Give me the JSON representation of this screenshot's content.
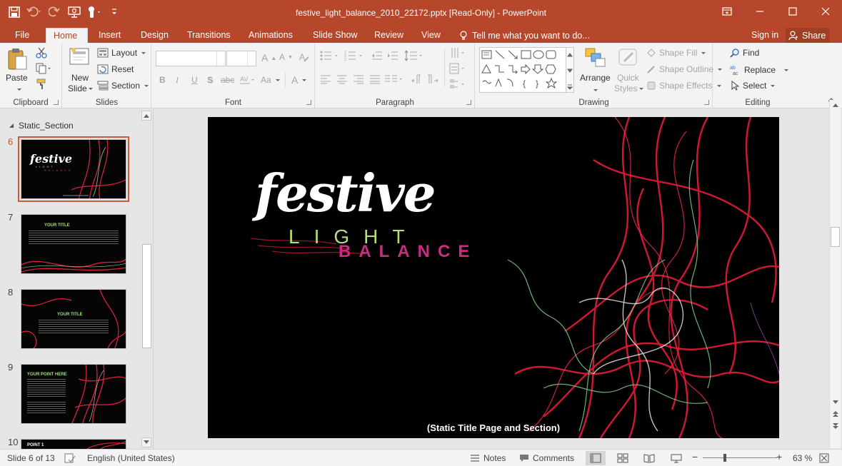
{
  "window": {
    "title": "festive_light_balance_2010_22172.pptx [Read-Only] - PowerPoint"
  },
  "quick_access": [
    "save-icon",
    "undo-icon",
    "redo-icon",
    "present-icon",
    "touch-mode-icon",
    "customize-icon"
  ],
  "tabs": [
    {
      "label": "File"
    },
    {
      "label": "Home",
      "active": true
    },
    {
      "label": "Insert"
    },
    {
      "label": "Design"
    },
    {
      "label": "Transitions"
    },
    {
      "label": "Animations"
    },
    {
      "label": "Slide Show"
    },
    {
      "label": "Review"
    },
    {
      "label": "View"
    }
  ],
  "tell_me": "Tell me what you want to do...",
  "sign_in": "Sign in",
  "share": "Share",
  "ribbon": {
    "clipboard": {
      "label": "Clipboard",
      "paste": "Paste"
    },
    "slides": {
      "label": "Slides",
      "new_slide_1": "New",
      "new_slide_2": "Slide",
      "layout": "Layout",
      "reset": "Reset",
      "section": "Section"
    },
    "font": {
      "label": "Font",
      "bold": "B",
      "italic": "I",
      "underline": "U",
      "shadow": "S",
      "strike": "abc",
      "case": "Aa",
      "color": "A"
    },
    "paragraph": {
      "label": "Paragraph"
    },
    "drawing": {
      "label": "Drawing",
      "arrange": "Arrange",
      "quick_styles_1": "Quick",
      "quick_styles_2": "Styles",
      "shape_fill": "Shape Fill",
      "shape_outline": "Shape Outline",
      "shape_effects": "Shape Effects"
    },
    "editing": {
      "label": "Editing",
      "find": "Find",
      "replace": "Replace",
      "select": "Select"
    }
  },
  "slides_pane": {
    "section": "Static_Section",
    "slides": [
      {
        "num": "6",
        "current": true
      },
      {
        "num": "7",
        "title": "YOUR TITLE"
      },
      {
        "num": "8",
        "title": "YOUR TITLE"
      },
      {
        "num": "9",
        "title": "YOUR POINT HERE"
      },
      {
        "num": "10",
        "title": "POINT 1"
      }
    ]
  },
  "slide": {
    "word1": "festive",
    "word2": "LIGHT",
    "word3": "BALANCE",
    "caption": "(Static Title Page and Section)"
  },
  "status": {
    "slide_of": "Slide 6 of 13",
    "language": "English (United States)",
    "notes": "Notes",
    "comments": "Comments",
    "zoom": "63 %",
    "zoom_level": 0.63
  },
  "colors": {
    "accent": "#b7472a",
    "light_green": "#b9dc78",
    "magenta": "#c72e83"
  }
}
